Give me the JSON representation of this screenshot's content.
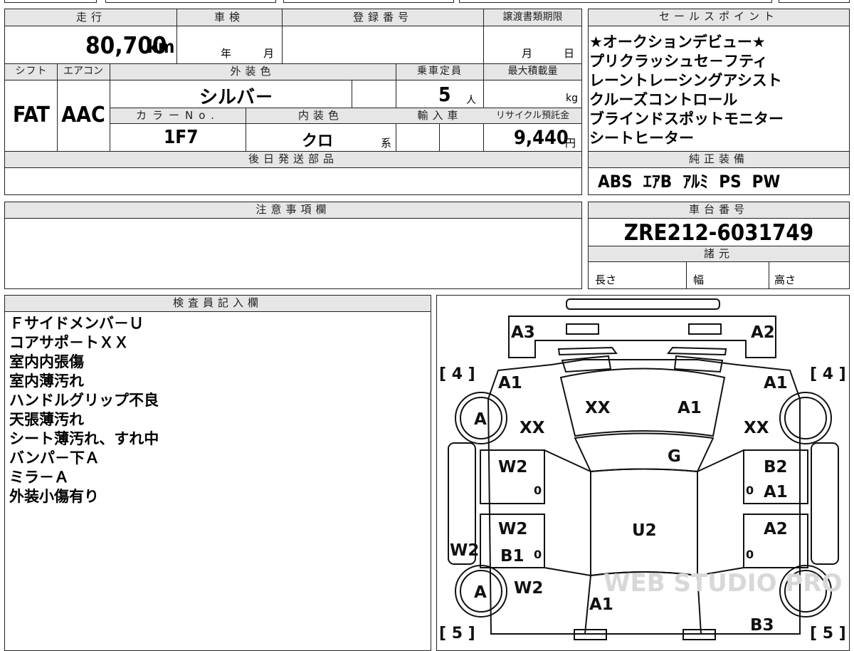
{
  "summary": {
    "mileage_header": "走行",
    "mileage": "80,700",
    "mileage_unit": "km",
    "shaken_header": "車検",
    "shaken_year_unit": "年",
    "shaken_month_unit": "月",
    "registration_header": "登録番号",
    "transfer_header": "譲渡書類期限",
    "transfer_month_unit": "月",
    "transfer_day_unit": "日",
    "shift_header": "シフト",
    "shift": "FAT",
    "ac_header": "エアコン",
    "ac": "AAC",
    "exterior_color_header": "外装色",
    "exterior_color": "シルバ－",
    "seating_header": "乗車定員",
    "seating": "5",
    "seating_unit": "人",
    "max_load_header": "最大積載量",
    "max_load_unit": "kg",
    "color_no_header": "カラーNo.",
    "color_no": "1F7",
    "interior_color_header": "内装色",
    "interior_color": "クロ",
    "interior_color_suffix": "系",
    "import_header": "輸入車",
    "recycle_header": "リサイクル預託金",
    "recycle_fee": "9,440",
    "recycle_unit": "円",
    "later_parts_header": "後日発送部品"
  },
  "sales_points": {
    "header": "セールスポイント",
    "items": [
      "★オークションデビュー★",
      "プリクラッシュセ－フティ",
      "レーントレーシングアシスト",
      "クルーズコントロール",
      "ブラインドスポットモニター",
      "シートヒーター"
    ]
  },
  "standard_equipment": {
    "header": "純正装備",
    "items": [
      "ABS",
      "ｴｱB",
      "ｱﾙﾐ",
      "PS",
      "PW"
    ]
  },
  "notes": {
    "header": "注意事項欄"
  },
  "chassis": {
    "header": "車台番号",
    "number": "ZRE212-6031749",
    "specs_header": "諸元",
    "length_label": "長さ",
    "width_label": "幅",
    "height_label": "高さ"
  },
  "inspector": {
    "header": "検査員記入欄",
    "items": [
      "Ｆサイドメンバ－Ｕ",
      "コアサポ－トＸＸ",
      "室内内張傷",
      "室内薄汚れ",
      "ハンドルグリップ不良",
      "天張薄汚れ",
      "シート薄汚れ、すれ中",
      "バンパ－下Ａ",
      "ミラ－Ａ",
      "外装小傷有り"
    ]
  },
  "diagram": {
    "tire_fl": "[ 4 ]",
    "tire_fr": "[ 4 ]",
    "tire_rl": "[ 5 ]",
    "tire_rr": "[ 5 ]",
    "watermark": "WEB STUDIO PRO",
    "marks": {
      "front_left_corner": "A3",
      "front_right_corner": "A2",
      "fender_left": "A1",
      "fender_right": "A1",
      "wheel_left": "A",
      "wheel_left_rear": "A",
      "fender_left_xx": "XX",
      "fender_right_xx": "XX",
      "hood_left": "XX",
      "hood_right": "A1",
      "windshield": "G",
      "front_door_left": "W2",
      "front_door_left_small": "0",
      "front_door_right_b2": "B2",
      "front_door_right_a1": "A1",
      "front_door_right_small": "0",
      "rear_door_left_w2": "W2",
      "rear_door_left_b1": "B1",
      "rear_door_left_small": "0",
      "rear_door_right": "A2",
      "rear_door_right_small": "0",
      "roof": "U2",
      "side_sill_left": "W2",
      "rear_fender_left": "W2",
      "trunk": "A1",
      "rear_right_corner": "B3"
    }
  }
}
